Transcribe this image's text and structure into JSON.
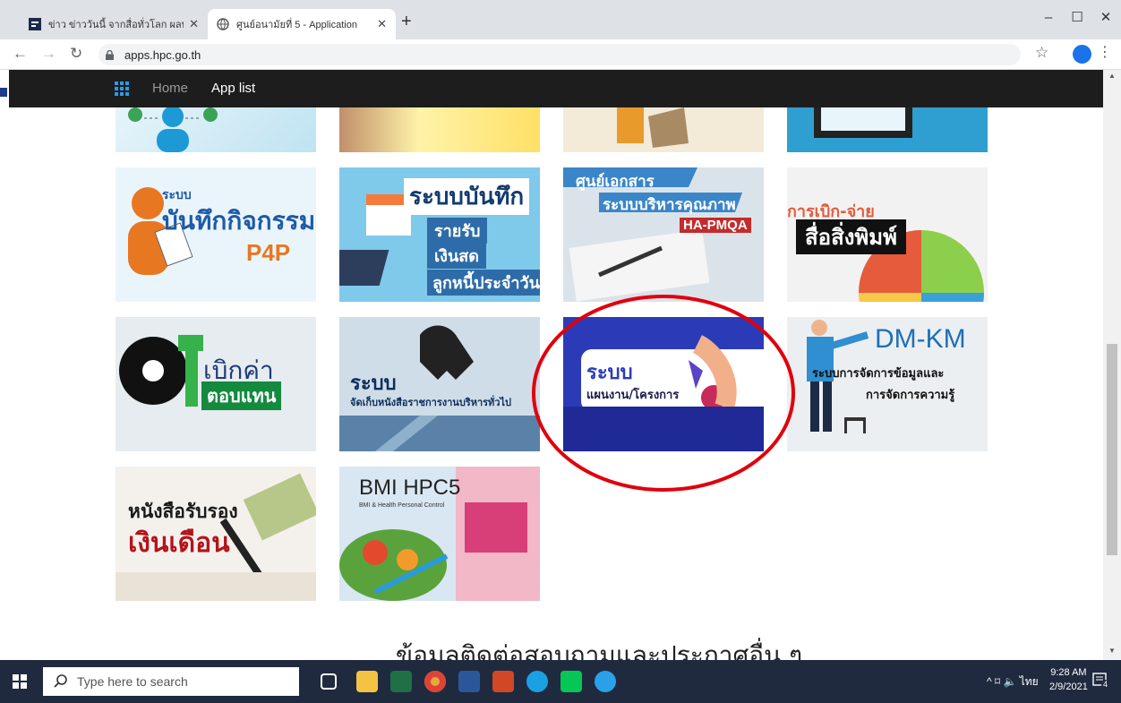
{
  "browser": {
    "tabs": [
      {
        "title": "ข่าว ข่าววันนี้ จากสื่อทั่วโลก ผลบอลล์"
      },
      {
        "title": "ศูนย์อนามัยที่ 5 - Application"
      }
    ],
    "url": "apps.hpc.go.th"
  },
  "navbar": {
    "home": "Home",
    "app_list": "App list"
  },
  "tiles": {
    "r2c1": {
      "l1": "ระบบ",
      "l2": "บันทึกกิจกรรม",
      "l3": "P4P"
    },
    "r2c2": {
      "l1": "ระบบบันทึก",
      "l2": "รายรับ",
      "l3": "เงินสด",
      "l4": "ลูกหนี้ประจำวัน"
    },
    "r2c3": {
      "l1": "ศูนย์เอกสาร",
      "l2": "ระบบบริหารคุณภาพ",
      "l3": "HA-PMQA"
    },
    "r2c4": {
      "l1": "การเบิก-จ่าย",
      "l2": "สื่อสิ่งพิมพ์"
    },
    "r3c1": {
      "l1": "เบิกค่า",
      "l2": "ตอบแทน"
    },
    "r3c2": {
      "l1": "ระบบ",
      "l2": "จัดเก็บหนังสือราชการงานบริหารทั่วไป"
    },
    "r3c3": {
      "l1": "ระบบ",
      "l2": "แผนงาน/โครงการ"
    },
    "r3c4": {
      "l1": "DM-KM",
      "l2": "ระบบการจัดการข้อมูลและ",
      "l3": "การจัดการความรู้"
    },
    "r4c1": {
      "l1": "หนังสือรับรอง",
      "l2": "เงินเดือน"
    },
    "r4c2": {
      "l1": "BMI  HPC5",
      "l2": "BMI & Health Personal Control"
    }
  },
  "footer_heading": "ข้อมูลติดต่อสอบถามและประกาศอื่น ๆ",
  "taskbar": {
    "search_placeholder": "Type here to search",
    "tray_lang": "ไทย",
    "time": "9:28 AM",
    "date": "2/9/2021",
    "notif_count": "4"
  },
  "colors": {
    "highlight_circle": "#e0000c",
    "navbar": "#1d1d1d",
    "accent_blue": "#1f3a8a"
  }
}
